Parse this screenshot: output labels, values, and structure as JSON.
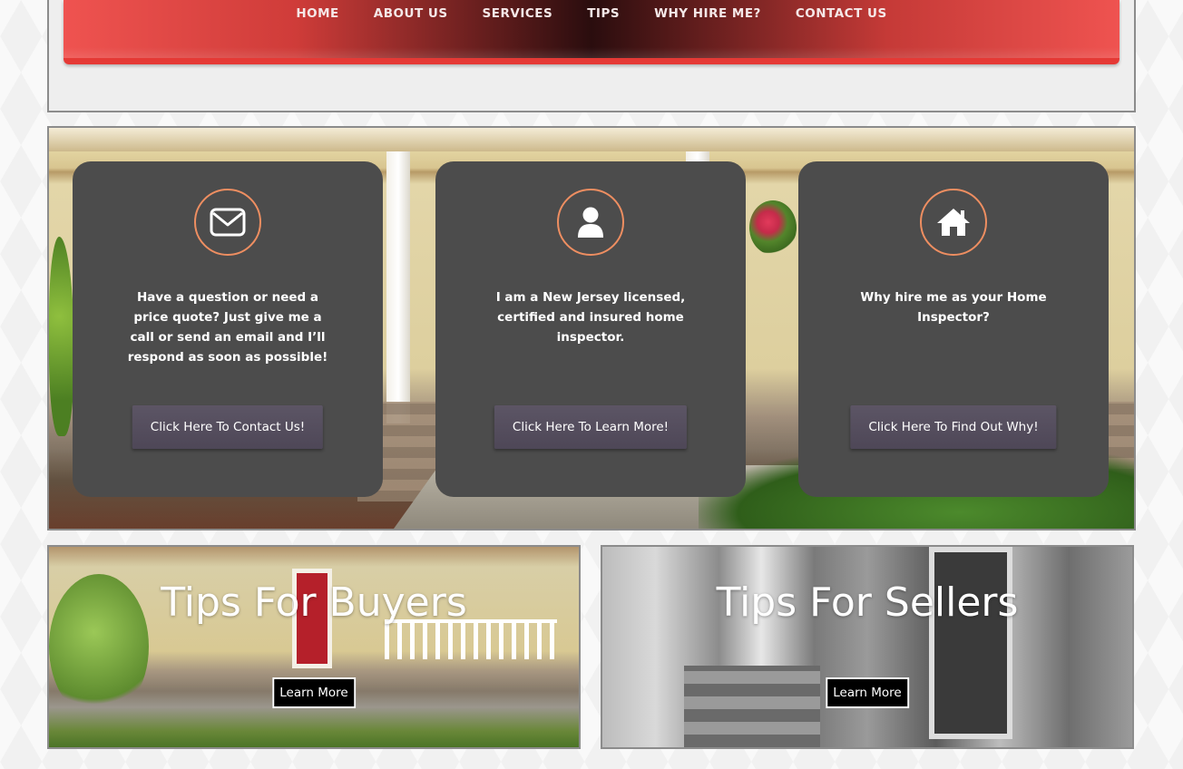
{
  "nav": {
    "items": [
      {
        "label": "HOME"
      },
      {
        "label": "ABOUT US"
      },
      {
        "label": "SERVICES"
      },
      {
        "label": "TIPS"
      },
      {
        "label": "WHY HIRE ME?"
      },
      {
        "label": "CONTACT US"
      }
    ]
  },
  "cards": [
    {
      "icon": "envelope-icon",
      "text": "Have a question or need a price quote? Just give me a call or send an email and I’ll respond as soon as possible!",
      "button": "Click Here To Contact Us!"
    },
    {
      "icon": "user-icon",
      "text": "I am a New Jersey licensed, certified and insured home inspector.",
      "button": "Click Here To Learn More!"
    },
    {
      "icon": "home-icon",
      "text": "Why hire me as your Home Inspector?",
      "button": "Click Here To Find Out Why!"
    }
  ],
  "tips": [
    {
      "title": "Tips For Buyers",
      "button": "Learn More"
    },
    {
      "title": "Tips For Sellers",
      "button": "Learn More"
    }
  ],
  "colors": {
    "nav_red": "#e53935",
    "nav_dark": "#2a0d0e",
    "card_bg": "#4c4c4c",
    "icon_ring": "#ee8e61",
    "card_button": "#5c5565"
  }
}
